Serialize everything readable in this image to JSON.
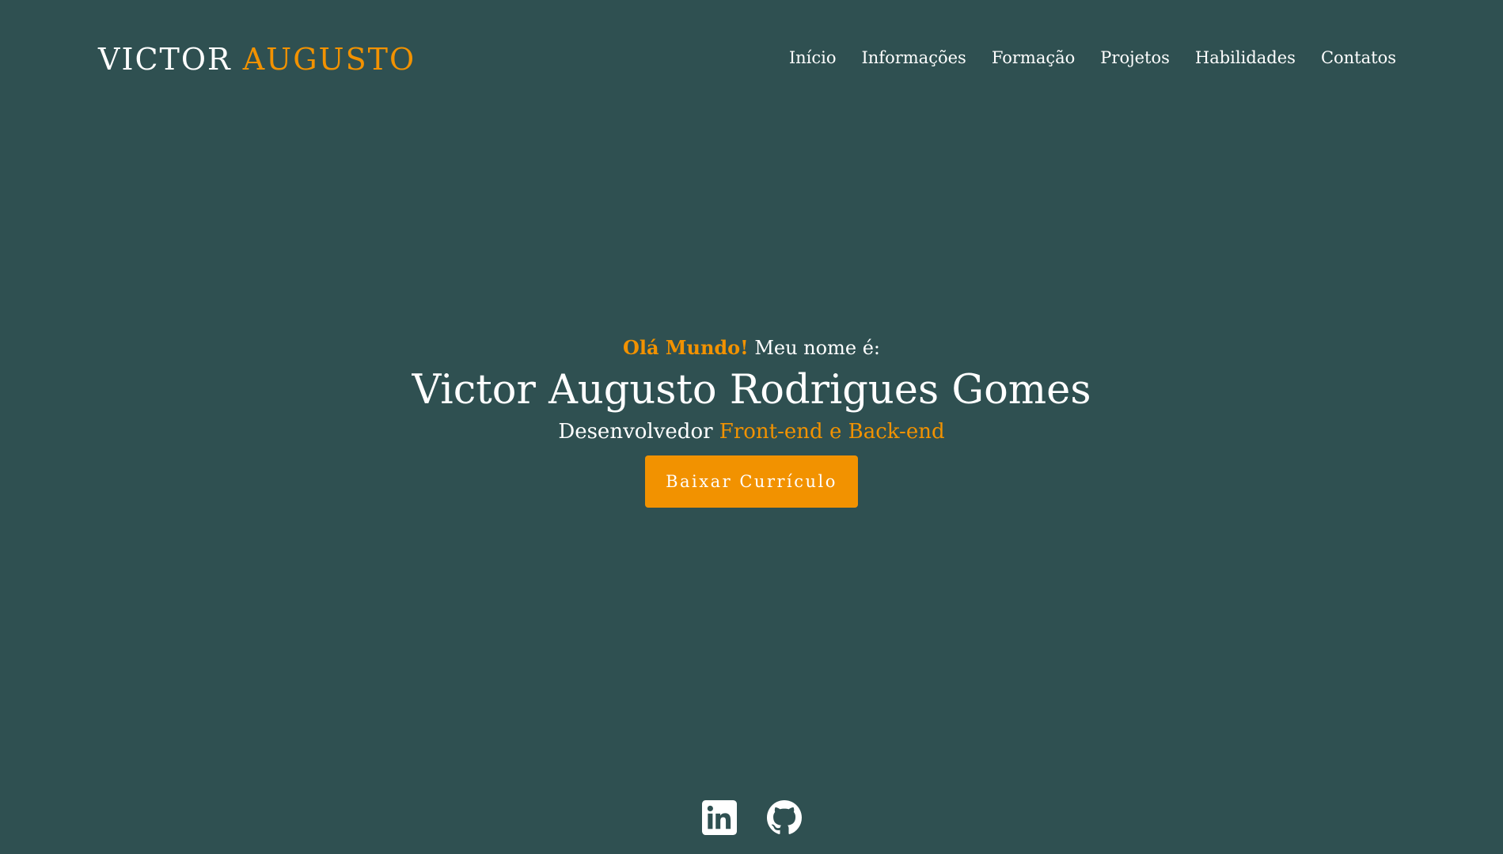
{
  "header": {
    "logo_first": "VICTOR",
    "logo_second": "AUGUSTO",
    "nav": [
      {
        "label": "Início"
      },
      {
        "label": "Informações"
      },
      {
        "label": "Formação"
      },
      {
        "label": "Projetos"
      },
      {
        "label": "Habilidades"
      },
      {
        "label": "Contatos"
      }
    ]
  },
  "hero": {
    "greeting_highlight": "Olá Mundo!",
    "greeting_rest": " Meu nome é:",
    "name": "Victor Augusto Rodrigues Gomes",
    "role_prefix": "Desenvolvedor ",
    "role_highlight": "Front-end e Back-end",
    "button_label": "Baixar Currículo"
  },
  "socials": [
    {
      "icon": "linkedin-icon"
    },
    {
      "icon": "github-icon"
    }
  ],
  "colors": {
    "background": "#2f5051",
    "accent": "#f29200",
    "text": "#ffffff"
  }
}
